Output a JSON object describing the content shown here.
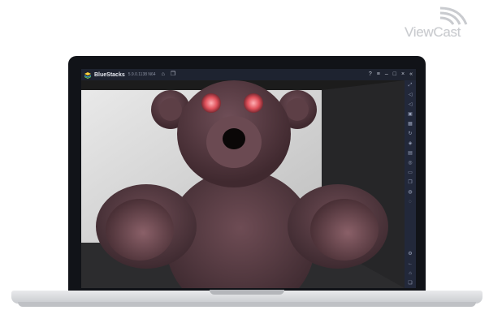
{
  "watermark": {
    "text": "ViewCast",
    "icon": "wifi-signal-icon"
  },
  "window": {
    "app_name": "BlueStacks",
    "app_version": "5.9.0.1138 N64",
    "title_icons": [
      "home-icon",
      "multi-window-icon"
    ],
    "controls": [
      "help-icon",
      "menu-icon",
      "minimize-icon",
      "maximize-icon",
      "close-icon",
      "collapse-icon"
    ]
  },
  "side_toolbar": {
    "top_icons": [
      "fullscreen-icon",
      "volume-up-icon",
      "volume-down-icon",
      "keyboard-icon",
      "gamepad-icon",
      "rotate-icon",
      "shake-icon",
      "screenshot-icon",
      "record-icon",
      "folder-icon",
      "copy-icon",
      "eco-icon",
      "sync-icon"
    ],
    "bottom_icons": [
      "settings-icon",
      "back-icon",
      "home-icon",
      "recent-apps-icon"
    ]
  },
  "colors": {
    "titlebar": "#1e2330",
    "toolbar": "#22283a",
    "bear": "#5a3e45",
    "eyes": "#e0505a"
  }
}
